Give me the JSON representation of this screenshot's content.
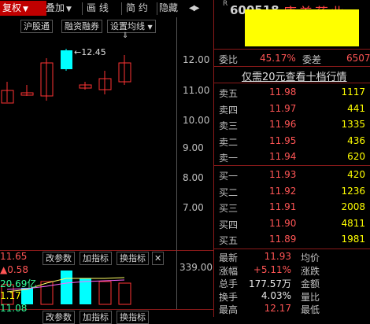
{
  "toolbar": {
    "items": [
      "复权",
      "叠加",
      "画 线",
      "简 约",
      "隐藏"
    ],
    "dropdown_arrow": "▼",
    "expand_arrows": "◀▶"
  },
  "stock_header": {
    "code": "600518",
    "name": "康美药业",
    "r_mark": "R"
  },
  "chart_buttons": {
    "hgt": "沪股通",
    "rzrq": "融资融券",
    "ma_setting": "设置均线",
    "ma_arrow": "▼"
  },
  "price_axis": [
    "12.00",
    "11.00",
    "10.00",
    "9.00",
    "8.00",
    "7.00"
  ],
  "high_label": "12.45",
  "volume_panel": {
    "buttons": [
      "改参数",
      "加指标",
      "换指标"
    ],
    "close_icon": "✕",
    "axis_label": "339.00"
  },
  "bottom_buttons": [
    "改参数",
    "加指标",
    "换指标"
  ],
  "order_book": {
    "ratio_label": "委比",
    "ratio_value": "45.17%",
    "diff_label": "委差",
    "diff_value": "6507",
    "promo": "仅需20元查看十档行情",
    "sells": [
      {
        "label": "卖五",
        "price": "11.98",
        "vol": "1117"
      },
      {
        "label": "卖四",
        "price": "11.97",
        "vol": "441"
      },
      {
        "label": "卖三",
        "price": "11.96",
        "vol": "1335"
      },
      {
        "label": "卖二",
        "price": "11.95",
        "vol": "436"
      },
      {
        "label": "卖一",
        "price": "11.94",
        "vol": "620"
      }
    ],
    "buys": [
      {
        "label": "买一",
        "price": "11.93",
        "vol": "420"
      },
      {
        "label": "买二",
        "price": "11.92",
        "vol": "1236"
      },
      {
        "label": "买三",
        "price": "11.91",
        "vol": "2008"
      },
      {
        "label": "买四",
        "price": "11.90",
        "vol": "4811"
      },
      {
        "label": "买五",
        "price": "11.89",
        "vol": "1981"
      }
    ]
  },
  "quote": [
    {
      "l1": "最新",
      "v1": "11.93",
      "l2": "均价",
      "v2": "11.65"
    },
    {
      "l1": "涨幅",
      "v1": "+5.11%",
      "l2": "涨跌",
      "v2": "▲0.58"
    },
    {
      "l1": "总手",
      "v1": "177.57万",
      "l2": "金额",
      "v2": "20.69亿"
    },
    {
      "l1": "换手",
      "v1": "4.03%",
      "l2": "量比",
      "v2": "1.17"
    },
    {
      "l1": "最高",
      "v1": "12.17",
      "l2": "最低",
      "v2": "11.08"
    }
  ],
  "colors": {
    "up": "#ff3333",
    "down": "#00ffff",
    "accent": "#c00000",
    "highlight": "#ffff00"
  }
}
